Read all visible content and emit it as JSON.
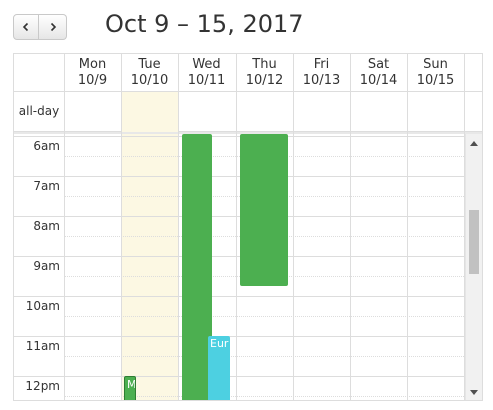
{
  "toolbar": {
    "prev_icon": "chevron-left-icon",
    "next_icon": "chevron-right-icon",
    "title": "Oct 9 – 15, 2017"
  },
  "calendar": {
    "days": [
      {
        "line1": "Mon",
        "line2": "10/9"
      },
      {
        "line1": "Tue",
        "line2": "10/10"
      },
      {
        "line1": "Wed",
        "line2": "10/11"
      },
      {
        "line1": "Thu",
        "line2": "10/12"
      },
      {
        "line1": "Fri 10/13",
        "line2": ""
      },
      {
        "line1": "Sat 10/14",
        "line2": ""
      },
      {
        "line1": "Sun",
        "line2": "10/15"
      }
    ],
    "allday_label": "all-day",
    "today_day_index": 1,
    "times": [
      "6am",
      "7am",
      "8am",
      "9am",
      "10am",
      "11am",
      "12pm"
    ],
    "events": [
      {
        "day": 1,
        "start": "12:00",
        "end": "after-12pm",
        "title": "M",
        "color": "#4caf50"
      },
      {
        "day": 2,
        "start": "before-6am",
        "end": "after-12pm",
        "title": "",
        "color": "#4caf50"
      },
      {
        "day": 2,
        "start": "11:00",
        "end": "after-12pm",
        "title": "Eur",
        "color": "#4dd0e1"
      },
      {
        "day": 3,
        "start": "before-6am",
        "end": "09:45",
        "title": "",
        "color": "#4caf50"
      }
    ]
  },
  "colors": {
    "today_bg": "#fcf8e3",
    "grid": "#dddddd",
    "event_green": "#4caf50",
    "event_cyan": "#4dd0e1"
  }
}
